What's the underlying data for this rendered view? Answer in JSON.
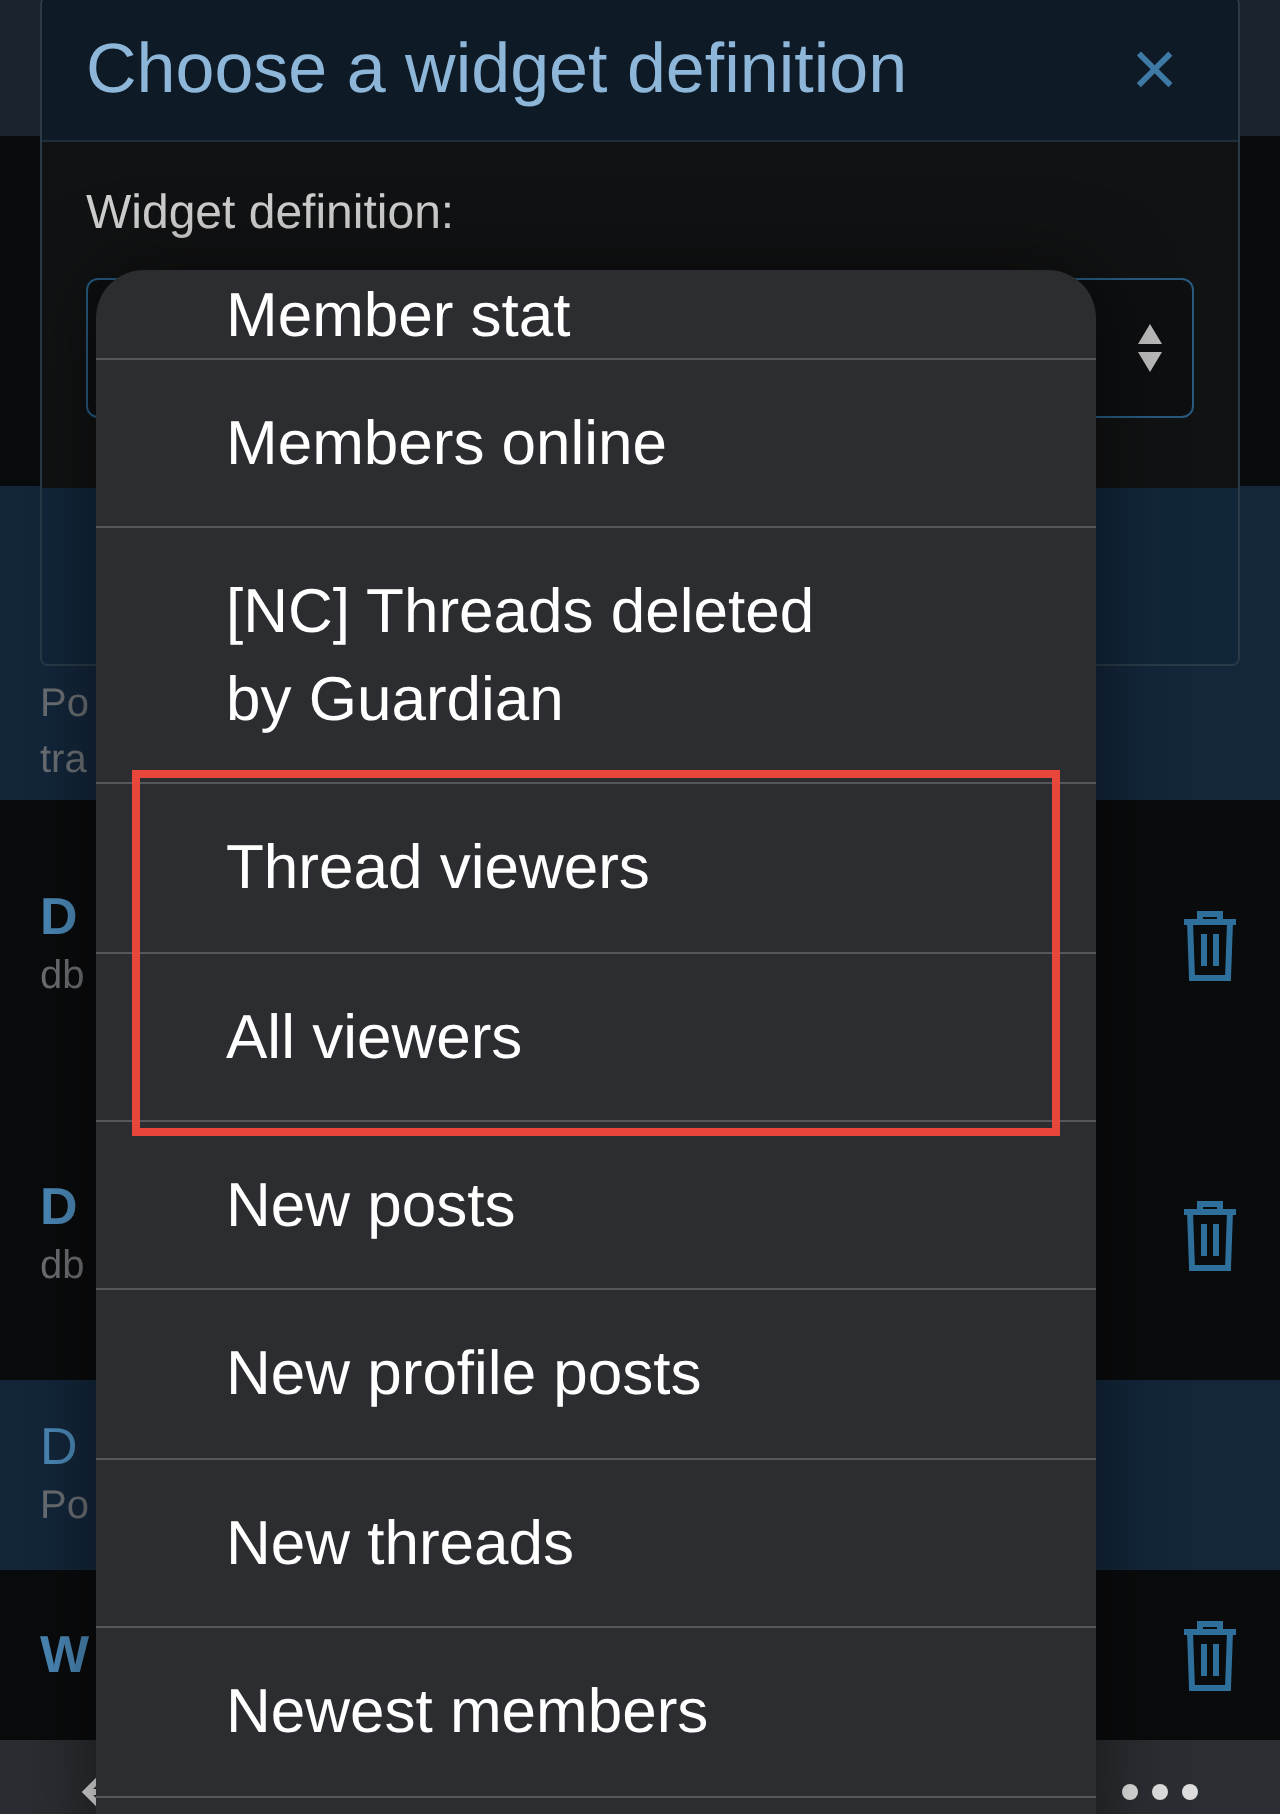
{
  "modal": {
    "title": "Choose a widget definition",
    "close": "×",
    "field_label": "Widget definition:"
  },
  "background_rows": [
    {
      "highlighted": true,
      "deletable": false,
      "lines": [
        "Po",
        "tra"
      ]
    },
    {
      "highlighted": false,
      "deletable": true,
      "title": "D",
      "subtitle": "db"
    },
    {
      "highlighted": false,
      "deletable": true,
      "title": "D",
      "subtitle": "db"
    },
    {
      "highlighted": true,
      "deletable": false,
      "title": "D",
      "subtitle": "Po"
    },
    {
      "highlighted": false,
      "deletable": true,
      "title": "W"
    }
  ],
  "picker_items": [
    {
      "label": "Member stat",
      "marked": false
    },
    {
      "label": "Members online",
      "marked": false
    },
    {
      "label": "[NC] Threads deleted by Guardian",
      "marked": false
    },
    {
      "label": "Thread viewers",
      "marked": true
    },
    {
      "label": "All viewers",
      "marked": true
    },
    {
      "label": "New posts",
      "marked": false
    },
    {
      "label": "New profile posts",
      "marked": false
    },
    {
      "label": "New threads",
      "marked": false
    },
    {
      "label": "Newest members",
      "marked": false
    }
  ]
}
